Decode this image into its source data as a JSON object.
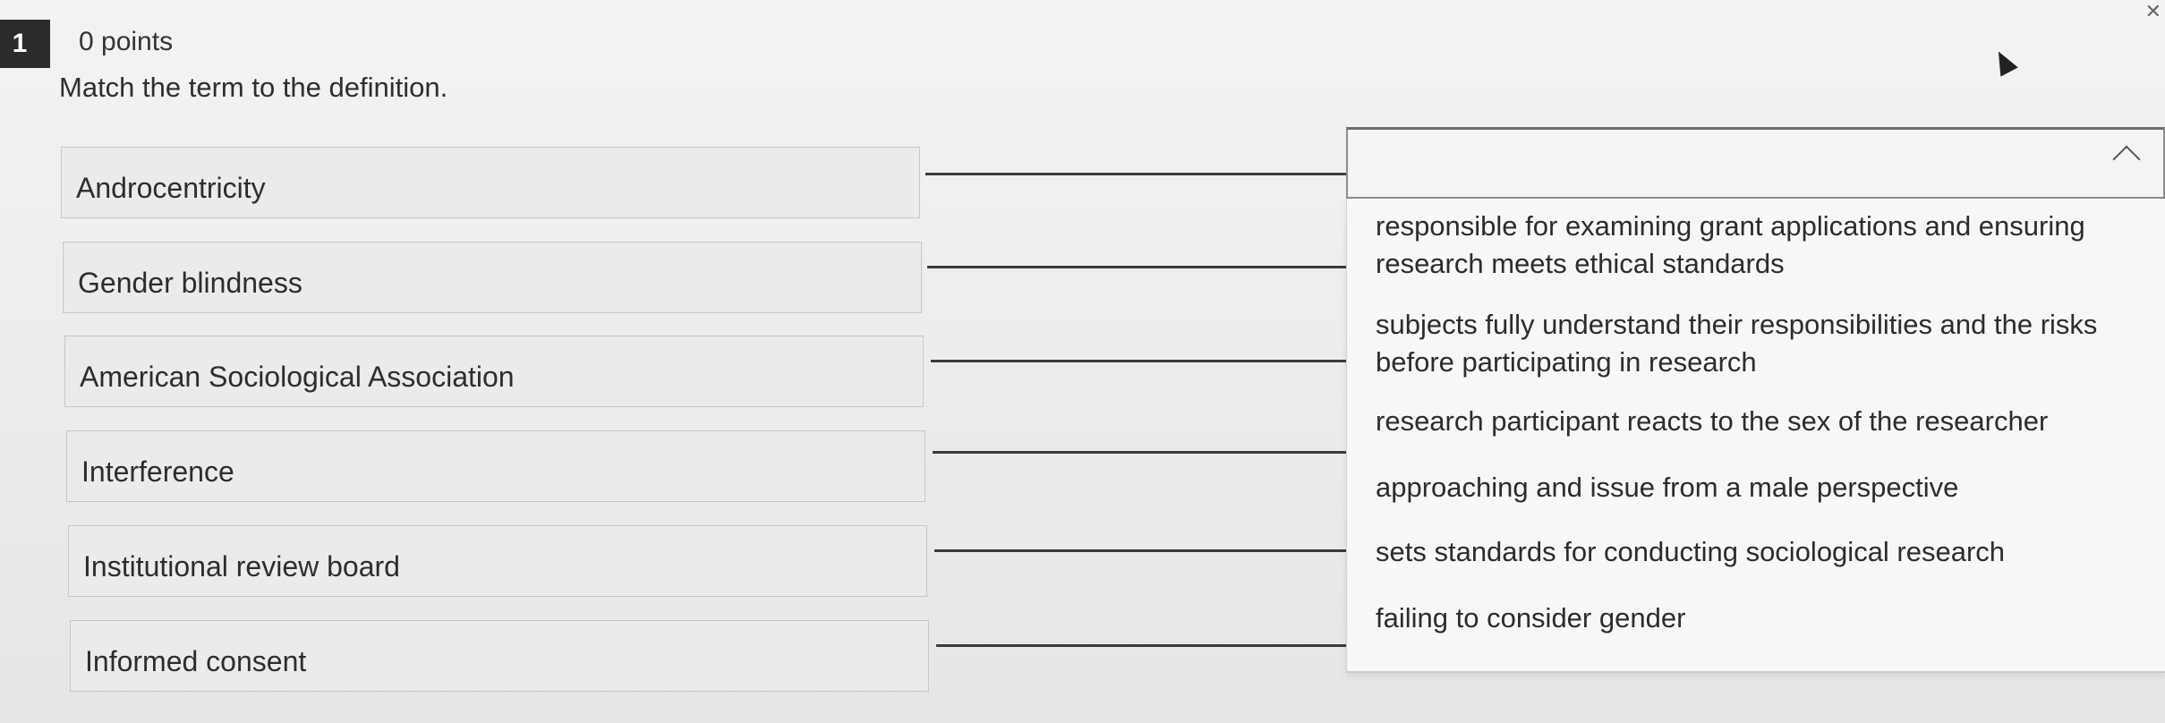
{
  "question": {
    "number": "1",
    "points": "0 points",
    "prompt": "Match the term to the definition."
  },
  "terms": [
    "Androcentricity",
    "Gender blindness",
    "American Sociological Association",
    "Interference",
    "Institutional review board",
    "Informed consent"
  ],
  "dropdown": {
    "selected": "",
    "options": [
      "responsible for examining grant applications and ensuring research meets ethical standards",
      "subjects fully understand their responsibilities and the risks before participating in research",
      "research participant reacts to the sex of the researcher",
      "approaching and issue from a male perspective",
      "sets standards for conducting sociological research",
      "failing to consider gender"
    ]
  },
  "icons": {
    "close": "close-icon",
    "chevron": "chevron-up-icon",
    "cursor": "cursor-icon"
  }
}
